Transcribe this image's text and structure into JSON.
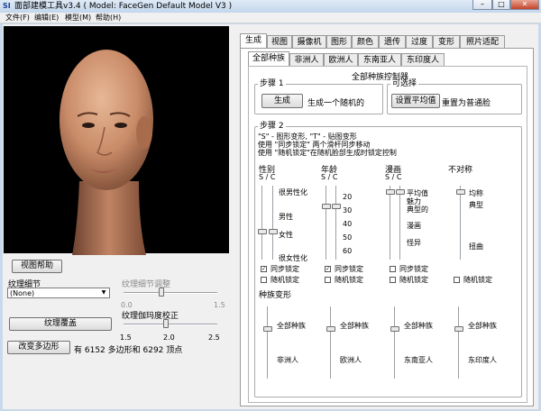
{
  "window": {
    "app_icon": "SI",
    "title": "面部建模工具v3.4  ( Model: FaceGen Default Model V3 )",
    "minimize": "–",
    "maximize": "□",
    "close": "✕"
  },
  "menu": [
    "文件(F)",
    "编辑(E)",
    "模型(M)",
    "帮助(H)"
  ],
  "left": {
    "view_help": "视图帮助",
    "texture_detail_label": "纹理细节",
    "texture_detail_value": "(None)",
    "texture_detail_adjust_label": "纹理细节调整",
    "texture_adjust_ticks": [
      "0.0",
      "1.5"
    ],
    "texture_adjust_value": 0.4,
    "texture_overlay_btn": "纹理覆盖",
    "gamma_label": "纹理伽玛度校正",
    "gamma_ticks": [
      "1.5",
      "2.0",
      "2.5"
    ],
    "gamma_value": 0.45,
    "change_polygons_btn": "改变多边形",
    "polygons_info": "有 6152 多边形和 6292 顶点"
  },
  "tabs": [
    "生成",
    "视图",
    "摄像机",
    "图形",
    "颜色",
    "遗传",
    "过度",
    "变形",
    "照片适配"
  ],
  "subtabs": [
    "全部种族",
    "非洲人",
    "欧洲人",
    "东南亚人",
    "东印度人"
  ],
  "controller": {
    "title": "全部种族控制器",
    "step1": {
      "title": "步骤 1",
      "generate_btn": "生成",
      "generate_desc": "生成一个随机的"
    },
    "optional": {
      "title": "可选择",
      "set_avg_btn": "设置平均值",
      "reset_desc": "重置为普通脸"
    },
    "step2": {
      "title": "步骤 2",
      "hint1": "\"S\" - 图形变形, \"T\" - 贴图变形",
      "hint2": "使用 \"同步锁定\" 两个滑杆同步移动",
      "hint3": "使用 \"随机锁定\"在随机脸部生成时锁定控制"
    },
    "columns": {
      "gender": {
        "title": "性别",
        "sc": "S / C",
        "labels": [
          "很男性化",
          "男性",
          "女性",
          "很女性化"
        ]
      },
      "age": {
        "title": "年龄",
        "sc": "S / C",
        "labels": [
          "20",
          "30",
          "40",
          "50",
          "60"
        ]
      },
      "caricature": {
        "title": "漫画",
        "sc": "S / C",
        "labels": [
          "平均值",
          "魅力",
          "典型的",
          "漫画",
          "怪异"
        ]
      },
      "asymmetry": {
        "title": "不对称",
        "labels": [
          "均称",
          "典型",
          "扭曲"
        ]
      }
    },
    "sync_lock": "同步锁定",
    "random_lock": "随机锁定",
    "race_morph": {
      "title": "种族变形",
      "labels_top": [
        "全部种族",
        "全部种族",
        "全部种族",
        "全部种族"
      ],
      "labels_bottom": [
        "非洲人",
        "欧洲人",
        "东南亚人",
        "东印度人"
      ]
    }
  }
}
